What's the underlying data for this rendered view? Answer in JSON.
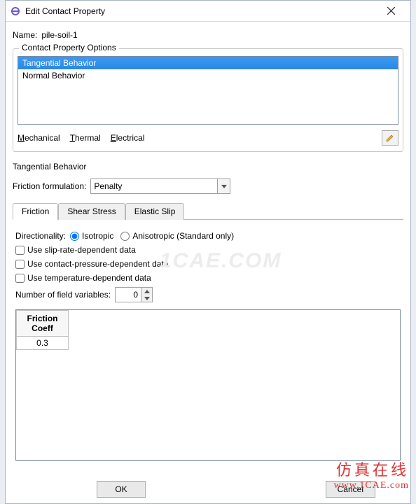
{
  "titlebar": {
    "title": "Edit Contact Property"
  },
  "name": {
    "label": "Name:",
    "value": "pile-soil-1"
  },
  "options": {
    "legend": "Contact Property Options",
    "items": [
      "Tangential Behavior",
      "Normal Behavior"
    ],
    "selected_index": 0,
    "menus": {
      "mechanical": "Mechanical",
      "thermal": "Thermal",
      "electrical": "Electrical"
    }
  },
  "section": {
    "title": "Tangential Behavior",
    "friction_formulation_label": "Friction formulation:",
    "friction_formulation_value": "Penalty"
  },
  "tabs": {
    "friction": "Friction",
    "shear": "Shear Stress",
    "slip": "Elastic Slip"
  },
  "friction_tab": {
    "directionality_label": "Directionality:",
    "isotropic": "Isotropic",
    "anisotropic": "Anisotropic (Standard only)",
    "slip_rate": "Use slip-rate-dependent data",
    "contact_pressure": "Use contact-pressure-dependent data",
    "temperature": "Use temperature-dependent data",
    "field_vars_label": "Number of field variables:",
    "field_vars_value": "0",
    "grid_header": "Friction\nCoeff",
    "grid_value": "0.3"
  },
  "buttons": {
    "ok": "OK",
    "cancel": "Cancel"
  },
  "watermark": {
    "cn": "仿真在线",
    "url": "www.1CAE.com",
    "bg": "1CAE.COM"
  }
}
